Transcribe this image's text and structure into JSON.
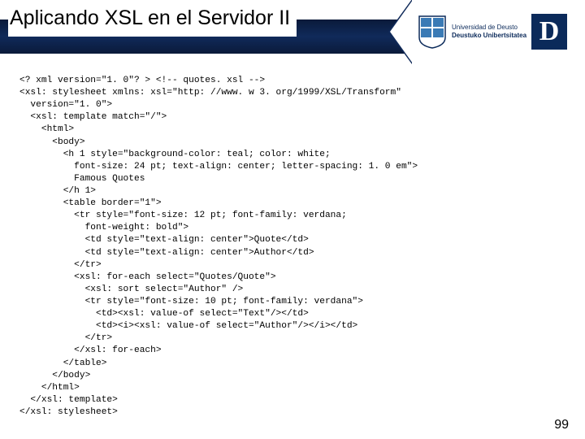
{
  "slide": {
    "title": "Aplicando XSL en el Servidor II",
    "page_number": "99"
  },
  "logo": {
    "university_line1": "Universidad de Deusto",
    "university_line2": "Deustuko Unibertsitatea",
    "letter": "D"
  },
  "code": {
    "content": "<? xml version=\"1. 0\"? > <!-- quotes. xsl -->\n<xsl: stylesheet xmlns: xsl=\"http: //www. w 3. org/1999/XSL/Transform\"\n  version=\"1. 0\">\n  <xsl: template match=\"/\">\n    <html>\n      <body>\n        <h 1 style=\"background-color: teal; color: white;\n          font-size: 24 pt; text-align: center; letter-spacing: 1. 0 em\">\n          Famous Quotes\n        </h 1>\n        <table border=\"1\">\n          <tr style=\"font-size: 12 pt; font-family: verdana;\n            font-weight: bold\">\n            <td style=\"text-align: center\">Quote</td>\n            <td style=\"text-align: center\">Author</td>\n          </tr>\n          <xsl: for-each select=\"Quotes/Quote\">\n            <xsl: sort select=\"Author\" />\n            <tr style=\"font-size: 10 pt; font-family: verdana\">\n              <td><xsl: value-of select=\"Text\"/></td>\n              <td><i><xsl: value-of select=\"Author\"/></i></td>\n            </tr>\n          </xsl: for-each>\n        </table>\n      </body>\n    </html>\n  </xsl: template>\n</xsl: stylesheet>"
  }
}
